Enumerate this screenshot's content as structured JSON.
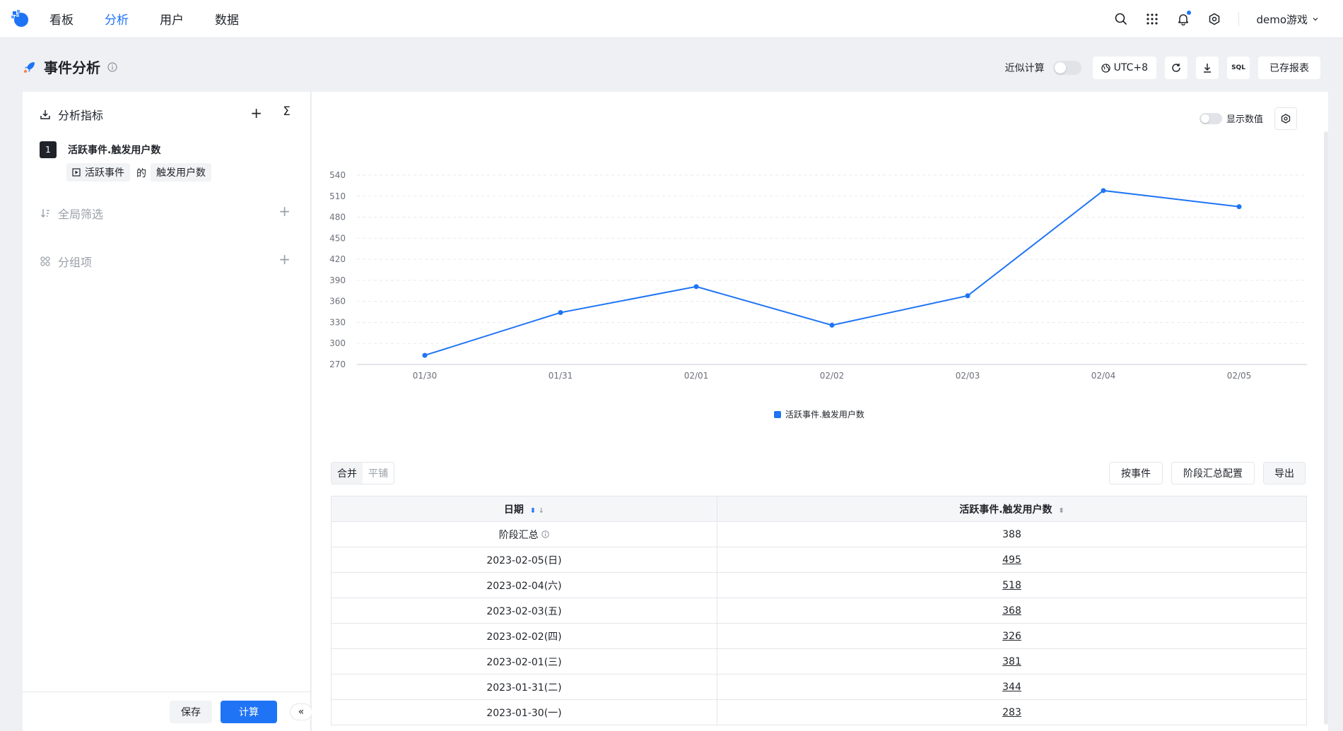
{
  "nav": {
    "items": [
      {
        "label": "看板",
        "active": false
      },
      {
        "label": "分析",
        "active": true
      },
      {
        "label": "用户",
        "active": false
      },
      {
        "label": "数据",
        "active": false
      }
    ],
    "user": "demo游戏"
  },
  "header": {
    "title": "事件分析",
    "approx_label": "近似计算",
    "approx_on": false,
    "timezone": "UTC+8",
    "sql_label": "SQL",
    "saved_reports": "已存报表"
  },
  "left": {
    "metrics_title": "分析指标",
    "metric": {
      "index": "1",
      "name": "活跃事件.触发用户数",
      "event_tag": "活跃事件",
      "connector": "的",
      "measure_tag": "触发用户数"
    },
    "filter_title": "全局筛选",
    "group_title": "分组项",
    "save_label": "保存",
    "calc_label": "计算",
    "collapse_label": "«"
  },
  "chart": {
    "show_values_label": "显示数值",
    "show_values_on": false
  },
  "chart_data": {
    "type": "line",
    "x": [
      "01/30",
      "01/31",
      "02/01",
      "02/02",
      "02/03",
      "02/04",
      "02/05"
    ],
    "series": [
      {
        "name": "活跃事件.触发用户数",
        "values": [
          283,
          344,
          381,
          326,
          368,
          518,
          495
        ],
        "color": "#1e74f5"
      }
    ],
    "yticks": [
      270,
      300,
      330,
      360,
      390,
      420,
      450,
      480,
      510,
      540
    ],
    "ylim": [
      270,
      540
    ],
    "grid": true,
    "legend": "bottom-center"
  },
  "table": {
    "seg": [
      "合并",
      "平铺"
    ],
    "by_event": "按事件",
    "stage_config": "阶段汇总配置",
    "export": "导出",
    "col_date": "日期",
    "col_metric": "活跃事件.触发用户数",
    "summary": {
      "label": "阶段汇总",
      "value": "388"
    },
    "rows": [
      {
        "date": "2023-02-05(日)",
        "value": "495"
      },
      {
        "date": "2023-02-04(六)",
        "value": "518"
      },
      {
        "date": "2023-02-03(五)",
        "value": "368"
      },
      {
        "date": "2023-02-02(四)",
        "value": "326"
      },
      {
        "date": "2023-02-01(三)",
        "value": "381"
      },
      {
        "date": "2023-01-31(二)",
        "value": "344"
      },
      {
        "date": "2023-01-30(一)",
        "value": "283"
      }
    ]
  }
}
